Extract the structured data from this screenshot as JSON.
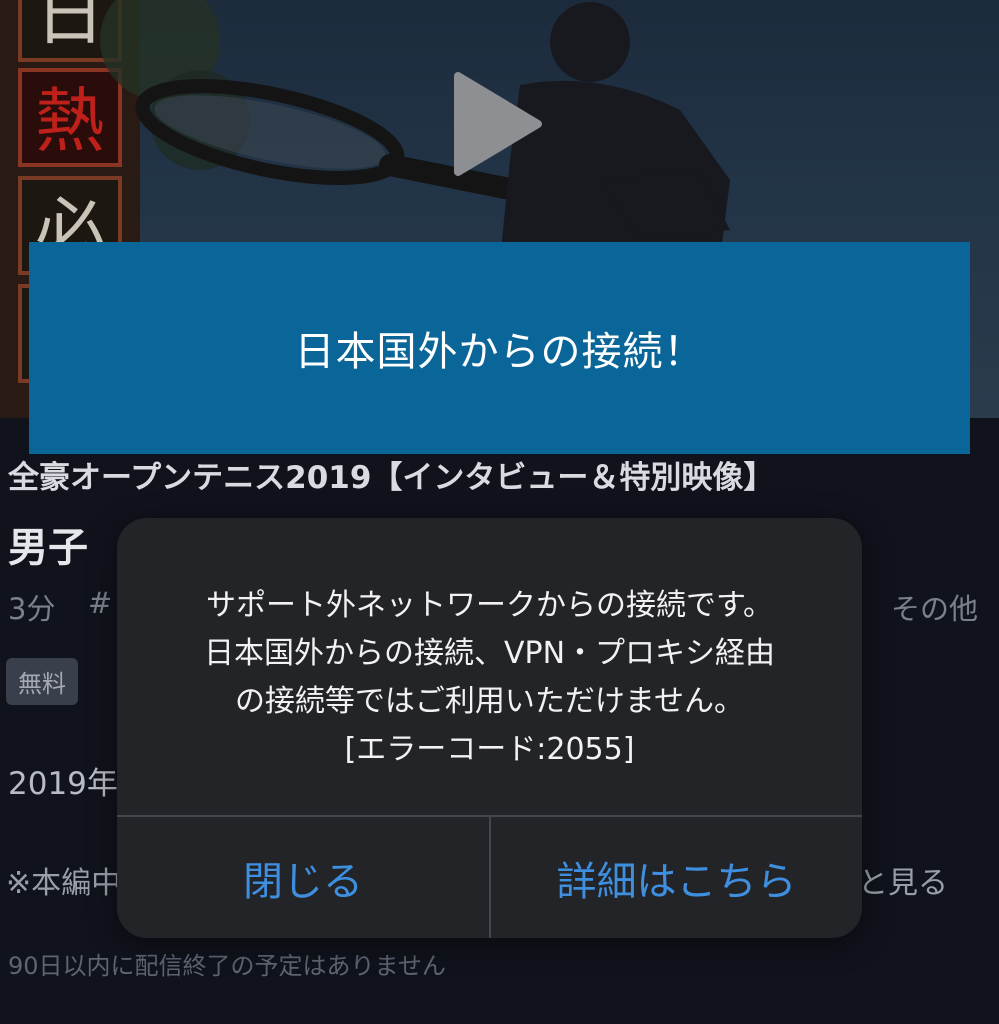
{
  "banner": {
    "text": "日本国外からの接続！"
  },
  "program": {
    "series_title": "全豪オープンテニス2019【インタビュー＆特別映像】",
    "episode_title": "男子 ",
    "duration": "3分",
    "tag_partial": "#",
    "more_label": "その他",
    "badge": "無料",
    "date_partial": "2019年",
    "note_partial": "※本編中",
    "note_tail": "と見る",
    "expiry": "90日以内に配信終了の予定はありません"
  },
  "alert": {
    "lines": [
      "サポート外ネットワークからの接続です。",
      "日本国外からの接続、VPN・プロキシ経由",
      "の接続等ではご利用いただけません。",
      "[エラーコード:2055]"
    ],
    "close_label": "閉じる",
    "details_label": "詳細はこちら"
  },
  "hero": {
    "signboard_chars": [
      "日",
      "熱",
      "必"
    ]
  },
  "colors": {
    "banner": "#0a6698",
    "alert_button_text": "#3f8fe0",
    "alert_background": "#232428",
    "page_background": "#10131c"
  },
  "icons": {
    "play": "play-icon"
  }
}
